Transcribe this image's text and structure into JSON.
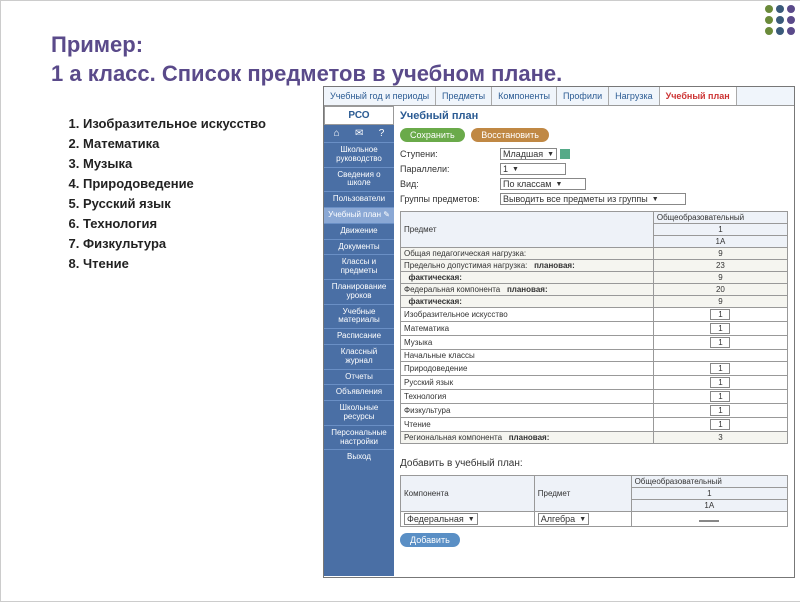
{
  "title_line1": "Пример:",
  "title_line2": "1 а класс. Список предметов в учебном плане.",
  "subjects": [
    "Изобразительное искусство",
    "Математика",
    "Музыка",
    "Природоведение",
    "Русский язык",
    "Технология",
    "Физкультура",
    "Чтение"
  ],
  "dotcolors": [
    "#6a8a3a",
    "#6a8a3a",
    "#6a8a3a",
    "#3a5a7a",
    "#3a5a7a",
    "#3a5a7a",
    "#5a4a8a",
    "#5a4a8a",
    "#5a4a8a"
  ],
  "app": {
    "logo": "РСО",
    "tabs": [
      "Учебный год и периоды",
      "Предметы",
      "Компоненты",
      "Профили",
      "Нагрузка",
      "Учебный план"
    ],
    "active_tab": 5,
    "sidebar": {
      "items": [
        "Школьное руководство",
        "Сведения о школе",
        "Пользователи",
        "Учебный план ✎",
        "Движение",
        "Документы",
        "Классы и предметы",
        "Планирование уроков",
        "Учебные материалы",
        "Расписание",
        "Классный журнал",
        "Отчеты",
        "Объявления",
        "Школьные ресурсы",
        "Персональные настройки",
        "Выход"
      ],
      "highlighted": 3
    },
    "section_title": "Учебный план",
    "buttons": {
      "save": "Сохранить",
      "restore": "Восстановить",
      "add": "Добавить"
    },
    "form": {
      "level_lbl": "Ступени:",
      "level": "Младшая",
      "parallel_lbl": "Параллели:",
      "parallel": "1",
      "kind_lbl": "Вид:",
      "kind": "По классам",
      "groups_lbl": "Группы предметов:",
      "groups": "Выводить все предметы из группы"
    },
    "table": {
      "col_subject": "Предмет",
      "col_group": "Общеобразовательный",
      "col_num": "1",
      "col_class": "1А",
      "rows_header": [
        {
          "label": "Общая педагогическая нагрузка:",
          "val": "9"
        },
        {
          "label": "Предельно допустимая нагрузка:",
          "sub": "плановая:",
          "val": "23"
        },
        {
          "label": "",
          "sub": "фактическая:",
          "val": "9"
        },
        {
          "label": "Федеральная компонента",
          "sub": "плановая:",
          "val": "20"
        },
        {
          "label": "",
          "sub": "фактическая:",
          "val": "9"
        }
      ],
      "subjects": [
        {
          "name": "Изобразительное искусство",
          "val": "1"
        },
        {
          "name": "Математика",
          "val": "1"
        },
        {
          "name": "Музыка",
          "val": "1"
        },
        {
          "name": "Начальные классы",
          "val": ""
        },
        {
          "name": "Природоведение",
          "val": "1"
        },
        {
          "name": "Русский язык",
          "val": "1"
        },
        {
          "name": "Технология",
          "val": "1"
        },
        {
          "name": "Физкультура",
          "val": "1"
        },
        {
          "name": "Чтение",
          "val": "1"
        }
      ],
      "regional": {
        "label": "Региональная компонента",
        "sub": "плановая:",
        "val": "3"
      }
    },
    "add_section": {
      "title": "Добавить в учебный план:",
      "col_component": "Компонента",
      "col_subject": "Предмет",
      "col_group": "Общеобразовательный",
      "col_num": "1",
      "col_class": "1А",
      "component": "Федеральная",
      "subject": "Алгебра"
    }
  }
}
